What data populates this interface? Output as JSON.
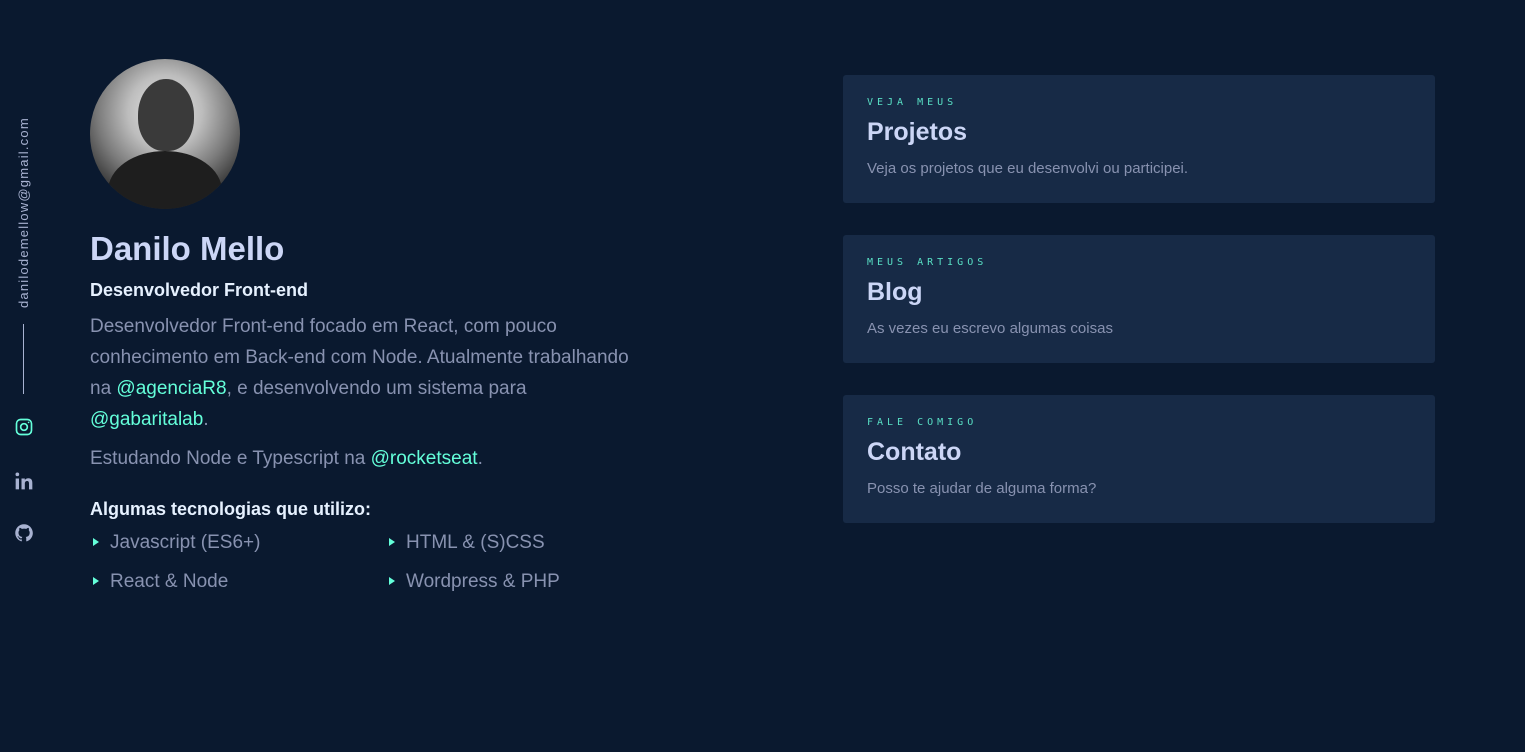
{
  "rail": {
    "email": "danilodemellow@gmail.com",
    "icons": [
      "instagram-icon",
      "linkedin-icon",
      "github-icon"
    ]
  },
  "profile": {
    "name": "Danilo Mello",
    "role": "Desenvolvedor Front-end",
    "bio": {
      "p1_part1": "Desenvolvedor Front-end focado em React, com pouco conhecimento em Back-end com Node. Atualmente trabalhando na ",
      "p1_link1": "@agenciaR8",
      "p1_part2": ", e desenvolvendo um sistema para ",
      "p1_link2": "@gabaritalab",
      "p1_part3": ".",
      "p2_part1": "Estudando Node e Typescript na ",
      "p2_link": "@rocketseat",
      "p2_part2": "."
    },
    "tech_title": "Algumas tecnologias que utilizo:",
    "tech": [
      "Javascript (ES6+)",
      "HTML & (S)CSS",
      "React & Node",
      "Wordpress & PHP"
    ]
  },
  "cards": [
    {
      "eyebrow": "VEJA MEUS",
      "title": "Projetos",
      "desc": "Veja os projetos que eu desenvolvi ou participei."
    },
    {
      "eyebrow": "MEUS ARTIGOS",
      "title": "Blog",
      "desc": "As vezes eu escrevo algumas coisas"
    },
    {
      "eyebrow": "FALE COMIGO",
      "title": "Contato",
      "desc": "Posso te ajudar de alguma forma?"
    }
  ],
  "colors": {
    "background": "#0a192f",
    "card": "#172a46",
    "accent": "#64ffda",
    "heading": "#ccd6f6",
    "text": "#8892b0"
  }
}
